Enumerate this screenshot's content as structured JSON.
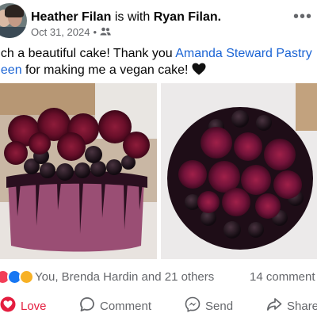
{
  "post": {
    "author": "Heather Filan",
    "with_text": "is with",
    "tagged": "Ryan Filan.",
    "date": "Oct 31, 2024",
    "separator": "•",
    "audience_icon": "friends-icon",
    "caption_lead": "uch a beautiful cake! Thank you ",
    "caption_link_1": "Amanda Steward Pastry",
    "caption_link_2": "ueen",
    "caption_tail": " for making me a vegan cake! ",
    "caption_emoji": "black-heart-icon"
  },
  "photos": [
    {
      "subject": "cake-with-roses-side"
    },
    {
      "subject": "cake-with-roses-top"
    }
  ],
  "reactions": {
    "icons": [
      "love-reaction-icon",
      "like-reaction-icon",
      "wow-reaction-icon"
    ],
    "summary": "You, Brenda Hardin and 21 others",
    "comments": "14 comment"
  },
  "actions": {
    "love": "Love",
    "comment": "Comment",
    "send": "Send",
    "share": "Share"
  },
  "colors": {
    "link": "#1b64d4",
    "secondary_text": "#65676b",
    "love_red": "#e41e3f"
  }
}
